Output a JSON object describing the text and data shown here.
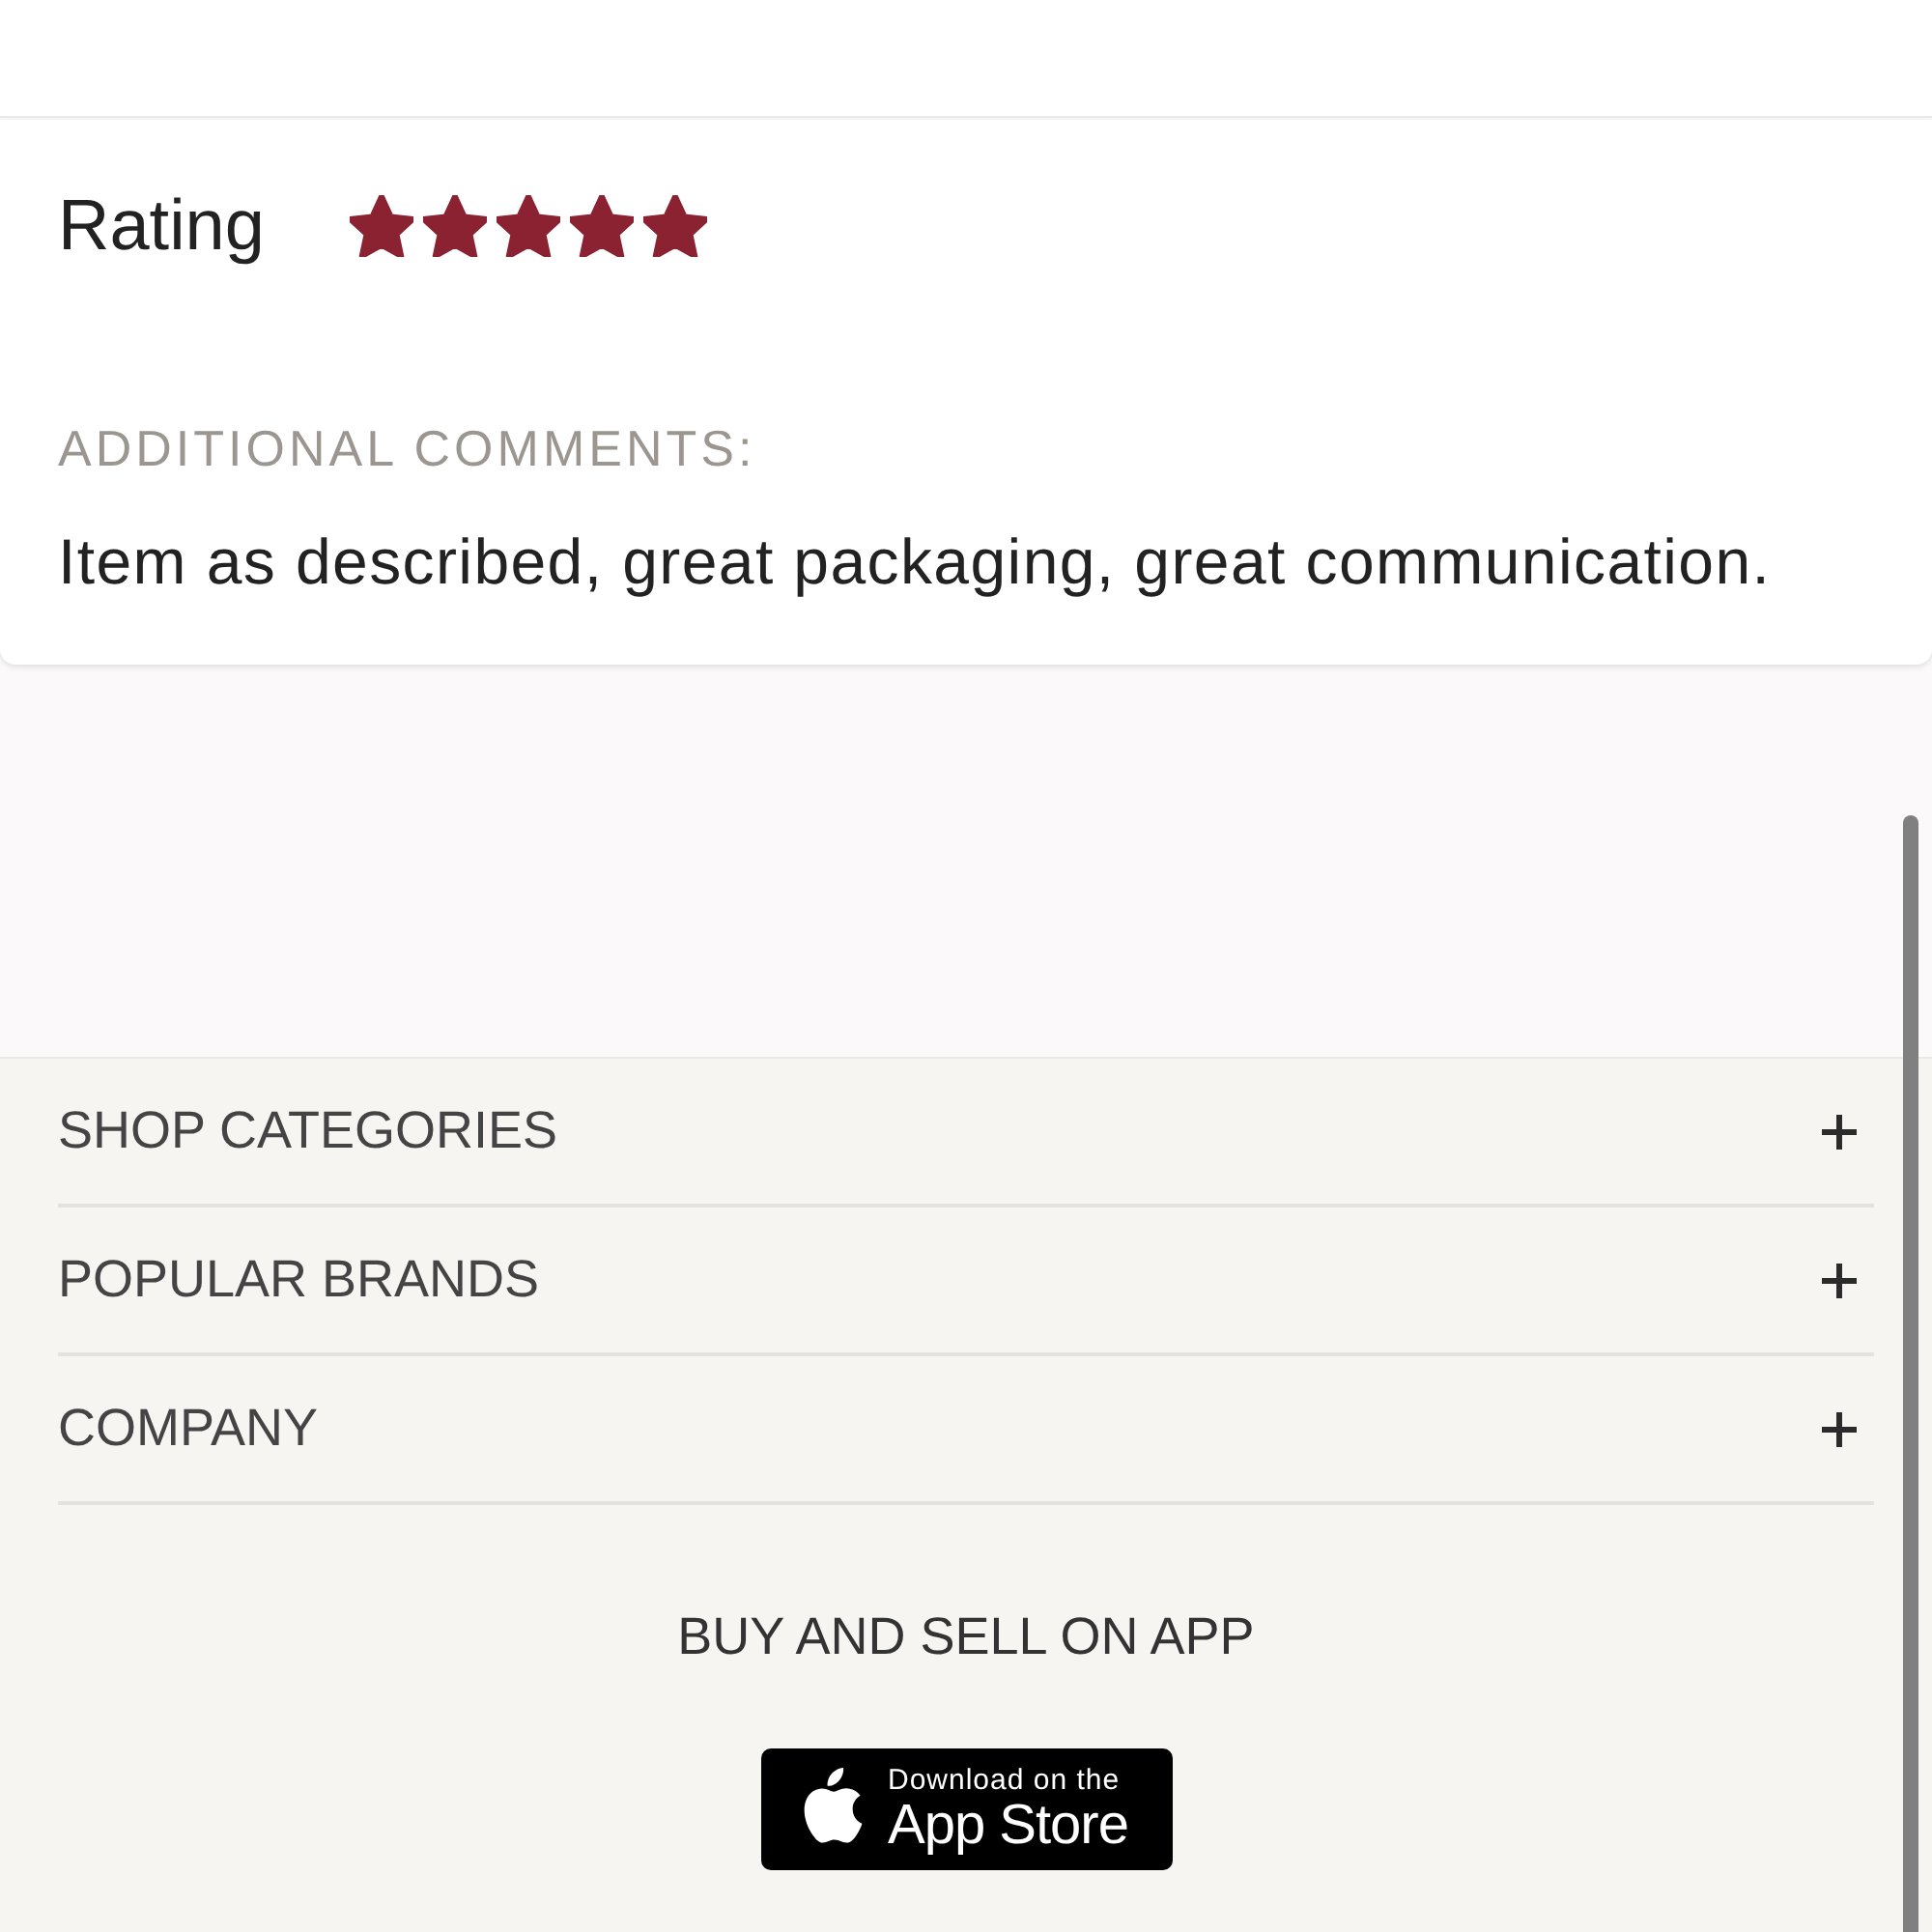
{
  "review": {
    "label": "Rating",
    "stars": 5,
    "comments_label": "ADDITIONAL COMMENTS:",
    "comment": "Item as described, great packaging, great communication."
  },
  "footer": {
    "sections": [
      {
        "label": "SHOP CATEGORIES",
        "expanded": false
      },
      {
        "label": "POPULAR BRANDS",
        "expanded": false
      },
      {
        "label": "COMPANY",
        "expanded": false
      }
    ],
    "app_heading": "BUY AND SELL ON APP",
    "app_store_badge": {
      "line_1": "Download on the",
      "line_2": "App Store"
    }
  }
}
